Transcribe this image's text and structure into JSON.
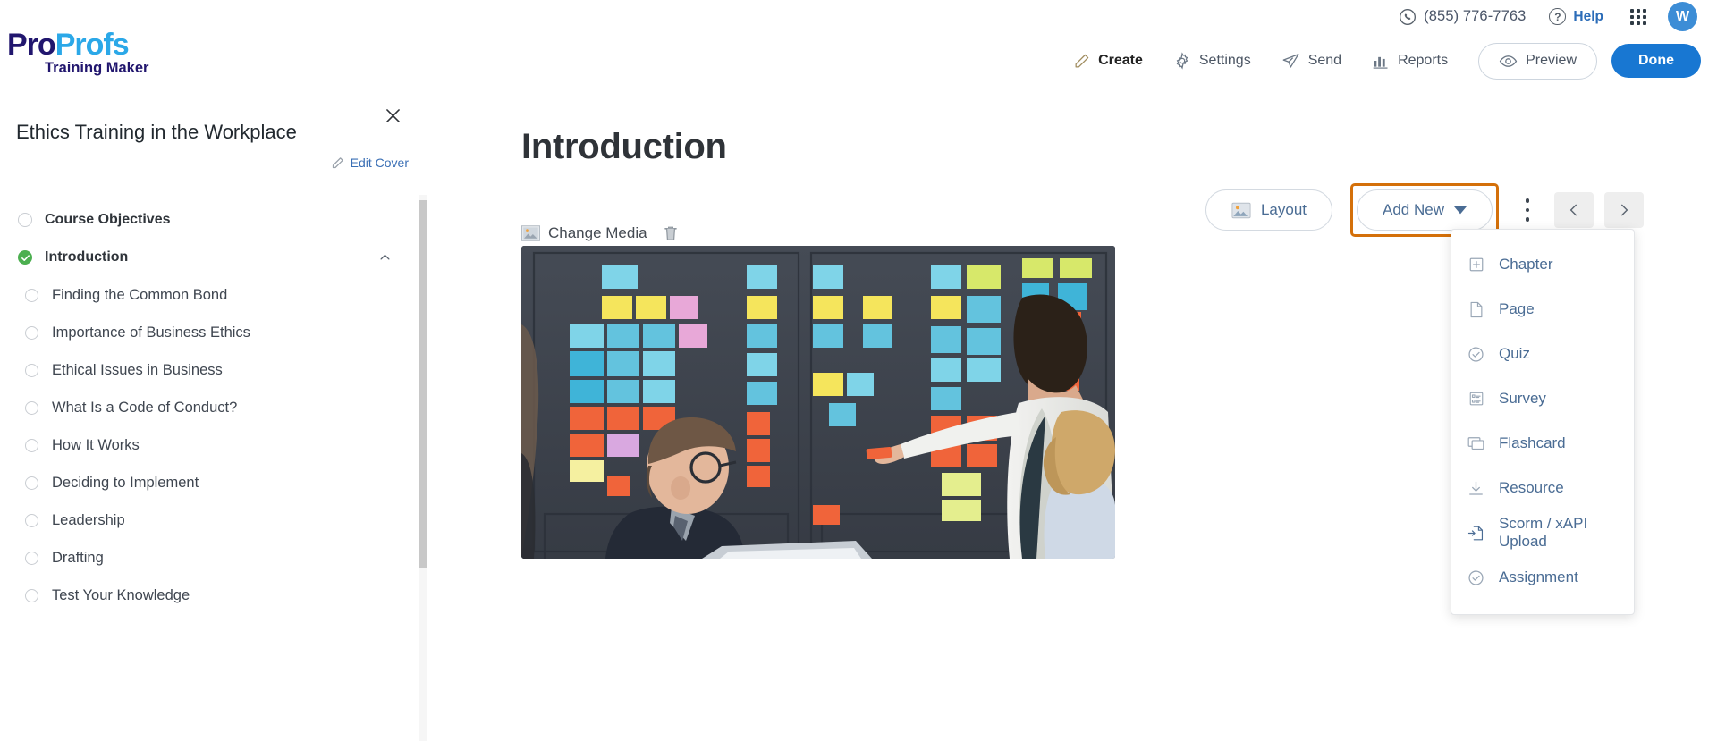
{
  "utility_bar": {
    "phone": "(855) 776-7763",
    "phone_icon": "phone-icon",
    "help_label": "Help",
    "help_icon": "question-circle-icon",
    "apps_icon": "apps-grid-icon",
    "avatar_initial": "W",
    "avatar_color": "#3c8dd6"
  },
  "brand": {
    "logo_part1": "Pro",
    "logo_part2": "Profs",
    "logo_subtitle": "Training Maker",
    "color_part1": "#21166e",
    "color_part2": "#2ba8e8"
  },
  "topnav": {
    "items": [
      {
        "label": "Create",
        "icon": "pencil-icon",
        "active": true
      },
      {
        "label": "Settings",
        "icon": "gear-icon",
        "active": false
      },
      {
        "label": "Send",
        "icon": "paper-plane-icon",
        "active": false
      },
      {
        "label": "Reports",
        "icon": "bar-chart-icon",
        "active": false
      }
    ],
    "preview_label": "Preview",
    "preview_icon": "eye-icon",
    "done_label": "Done",
    "done_color": "#1877d2"
  },
  "sidebar": {
    "course_title": "Ethics Training in the Workplace",
    "close_icon": "close-icon",
    "edit_cover_label": "Edit Cover",
    "edit_cover_icon": "pencil-icon",
    "items": [
      {
        "label": "Course Objectives",
        "level": "top",
        "state": "empty"
      },
      {
        "label": "Introduction",
        "level": "top",
        "state": "done",
        "chevron": "chevron-up-icon"
      },
      {
        "label": "Finding the Common Bond",
        "level": "child",
        "state": "empty"
      },
      {
        "label": "Importance of Business Ethics",
        "level": "child",
        "state": "empty"
      },
      {
        "label": "Ethical Issues in Business",
        "level": "child",
        "state": "empty"
      },
      {
        "label": "What Is a Code of Conduct?",
        "level": "child",
        "state": "empty"
      },
      {
        "label": "How It Works",
        "level": "child",
        "state": "empty"
      },
      {
        "label": "Deciding to Implement",
        "level": "child",
        "state": "empty"
      },
      {
        "label": "Leadership",
        "level": "child",
        "state": "empty"
      },
      {
        "label": "Drafting",
        "level": "child",
        "state": "empty"
      },
      {
        "label": "Test Your Knowledge",
        "level": "child",
        "state": "empty"
      }
    ],
    "done_color": "#4caf50"
  },
  "main": {
    "page_title": "Introduction",
    "media": {
      "change_label": "Change  Media",
      "change_icon": "image-icon",
      "delete_icon": "trash-icon",
      "alt": "Business team reviewing colorful sticky notes on a dark wall"
    },
    "toolbar": {
      "layout_label": "Layout",
      "layout_icon": "image-icon",
      "add_new_label": "Add  New",
      "add_new_caret_icon": "caret-down-icon",
      "add_new_highlight_color": "#d4700a",
      "kebab_icon": "more-vertical-icon",
      "prev_icon": "chevron-left-icon",
      "next_icon": "chevron-right-icon"
    },
    "dropdown": {
      "open": true,
      "items": [
        {
          "label": "Chapter",
          "icon": "plus-box-icon"
        },
        {
          "label": "Page",
          "icon": "page-icon"
        },
        {
          "label": "Quiz",
          "icon": "check-circle-icon"
        },
        {
          "label": "Survey",
          "icon": "survey-list-icon"
        },
        {
          "label": "Flashcard",
          "icon": "cards-icon"
        },
        {
          "label": "Resource",
          "icon": "download-icon"
        },
        {
          "label": "Scorm  /  xAPI  Upload",
          "icon": "file-import-icon"
        },
        {
          "label": "Assignment",
          "icon": "check-circle-icon"
        }
      ]
    }
  }
}
